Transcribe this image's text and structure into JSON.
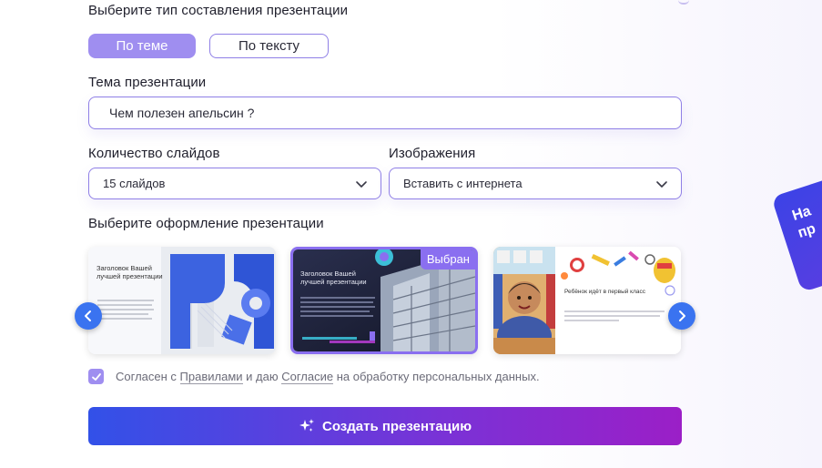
{
  "form": {
    "type_label": "Выберите тип составления презентации",
    "type_options": [
      {
        "label": "По теме",
        "active": true
      },
      {
        "label": "По тексту",
        "active": false
      }
    ],
    "topic_label": "Тема презентации",
    "topic_value": "Чем полезен апельсин ?",
    "slides_label": "Количество слайдов",
    "slides_value": "15 слайдов",
    "images_label": "Изображения",
    "images_value": "Вставить с интернета",
    "design_label": "Выберите оформление презентации",
    "selected_badge": "Выбран",
    "consent_prefix": "Согласен с ",
    "consent_rules": "Правилами",
    "consent_middle": " и даю ",
    "consent_agreement": "Согласие",
    "consent_suffix": " на обработку персональных данных.",
    "submit_label": "Создать презентацию"
  },
  "templates": [
    {
      "title": "Заголовок Вашей лучшей презентации",
      "selected": false
    },
    {
      "title": "Заголовок Вашей лучшей презентации",
      "selected": true
    },
    {
      "title": "Ребёнок идёт в первый класс",
      "selected": false
    }
  ],
  "side_banner": {
    "text_line1": "На",
    "text_line2": "пр"
  },
  "colors": {
    "accent": "#9f8ef0",
    "border": "#8f7fe6",
    "arrow": "#3a73f0",
    "cta_start": "#3251e8",
    "cta_end": "#9b1fc7"
  }
}
